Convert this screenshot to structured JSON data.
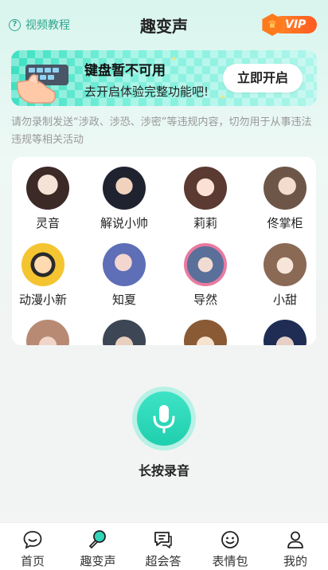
{
  "header": {
    "tutorial_label": "视频教程",
    "title": "趣变声",
    "vip_label": "VIP"
  },
  "banner": {
    "title": "键盘暂不可用",
    "subtitle": "去开启体验完整功能吧!",
    "button_label": "立即开启"
  },
  "notice": "请勿录制发送“涉政、涉恐、涉密”等违规内容，切勿用于从事违法违规等相关活动",
  "voices": [
    {
      "name": "灵音",
      "color": "#d9c7bd"
    },
    {
      "name": "解说小帅",
      "color": "#3a3f52"
    },
    {
      "name": "莉莉",
      "color": "#e7c3b5"
    },
    {
      "name": "佟掌柜",
      "color": "#b9a08f"
    },
    {
      "name": "动漫小新",
      "color": "#f4c531"
    },
    {
      "name": "知夏",
      "color": "#6f8fd8"
    },
    {
      "name": "导然",
      "color": "#9fb3d6"
    },
    {
      "name": "小甜",
      "color": "#e9d6c6"
    },
    {
      "name": "",
      "color": "#d9b8a6"
    },
    {
      "name": "",
      "color": "#5b6a7a"
    },
    {
      "name": "",
      "color": "#c99d6a"
    },
    {
      "name": "",
      "color": "#2d3f6a"
    }
  ],
  "record_label": "长按录音",
  "tabs": [
    {
      "label": "首页",
      "icon": "chat-bubble-icon"
    },
    {
      "label": "趣变声",
      "icon": "microphone-icon",
      "active": true
    },
    {
      "label": "超会答",
      "icon": "message-box-icon"
    },
    {
      "label": "表情包",
      "icon": "smiley-icon"
    },
    {
      "label": "我的",
      "icon": "user-icon"
    }
  ],
  "colors": {
    "accent": "#1fcfae",
    "vip": "#ff6a1f"
  }
}
